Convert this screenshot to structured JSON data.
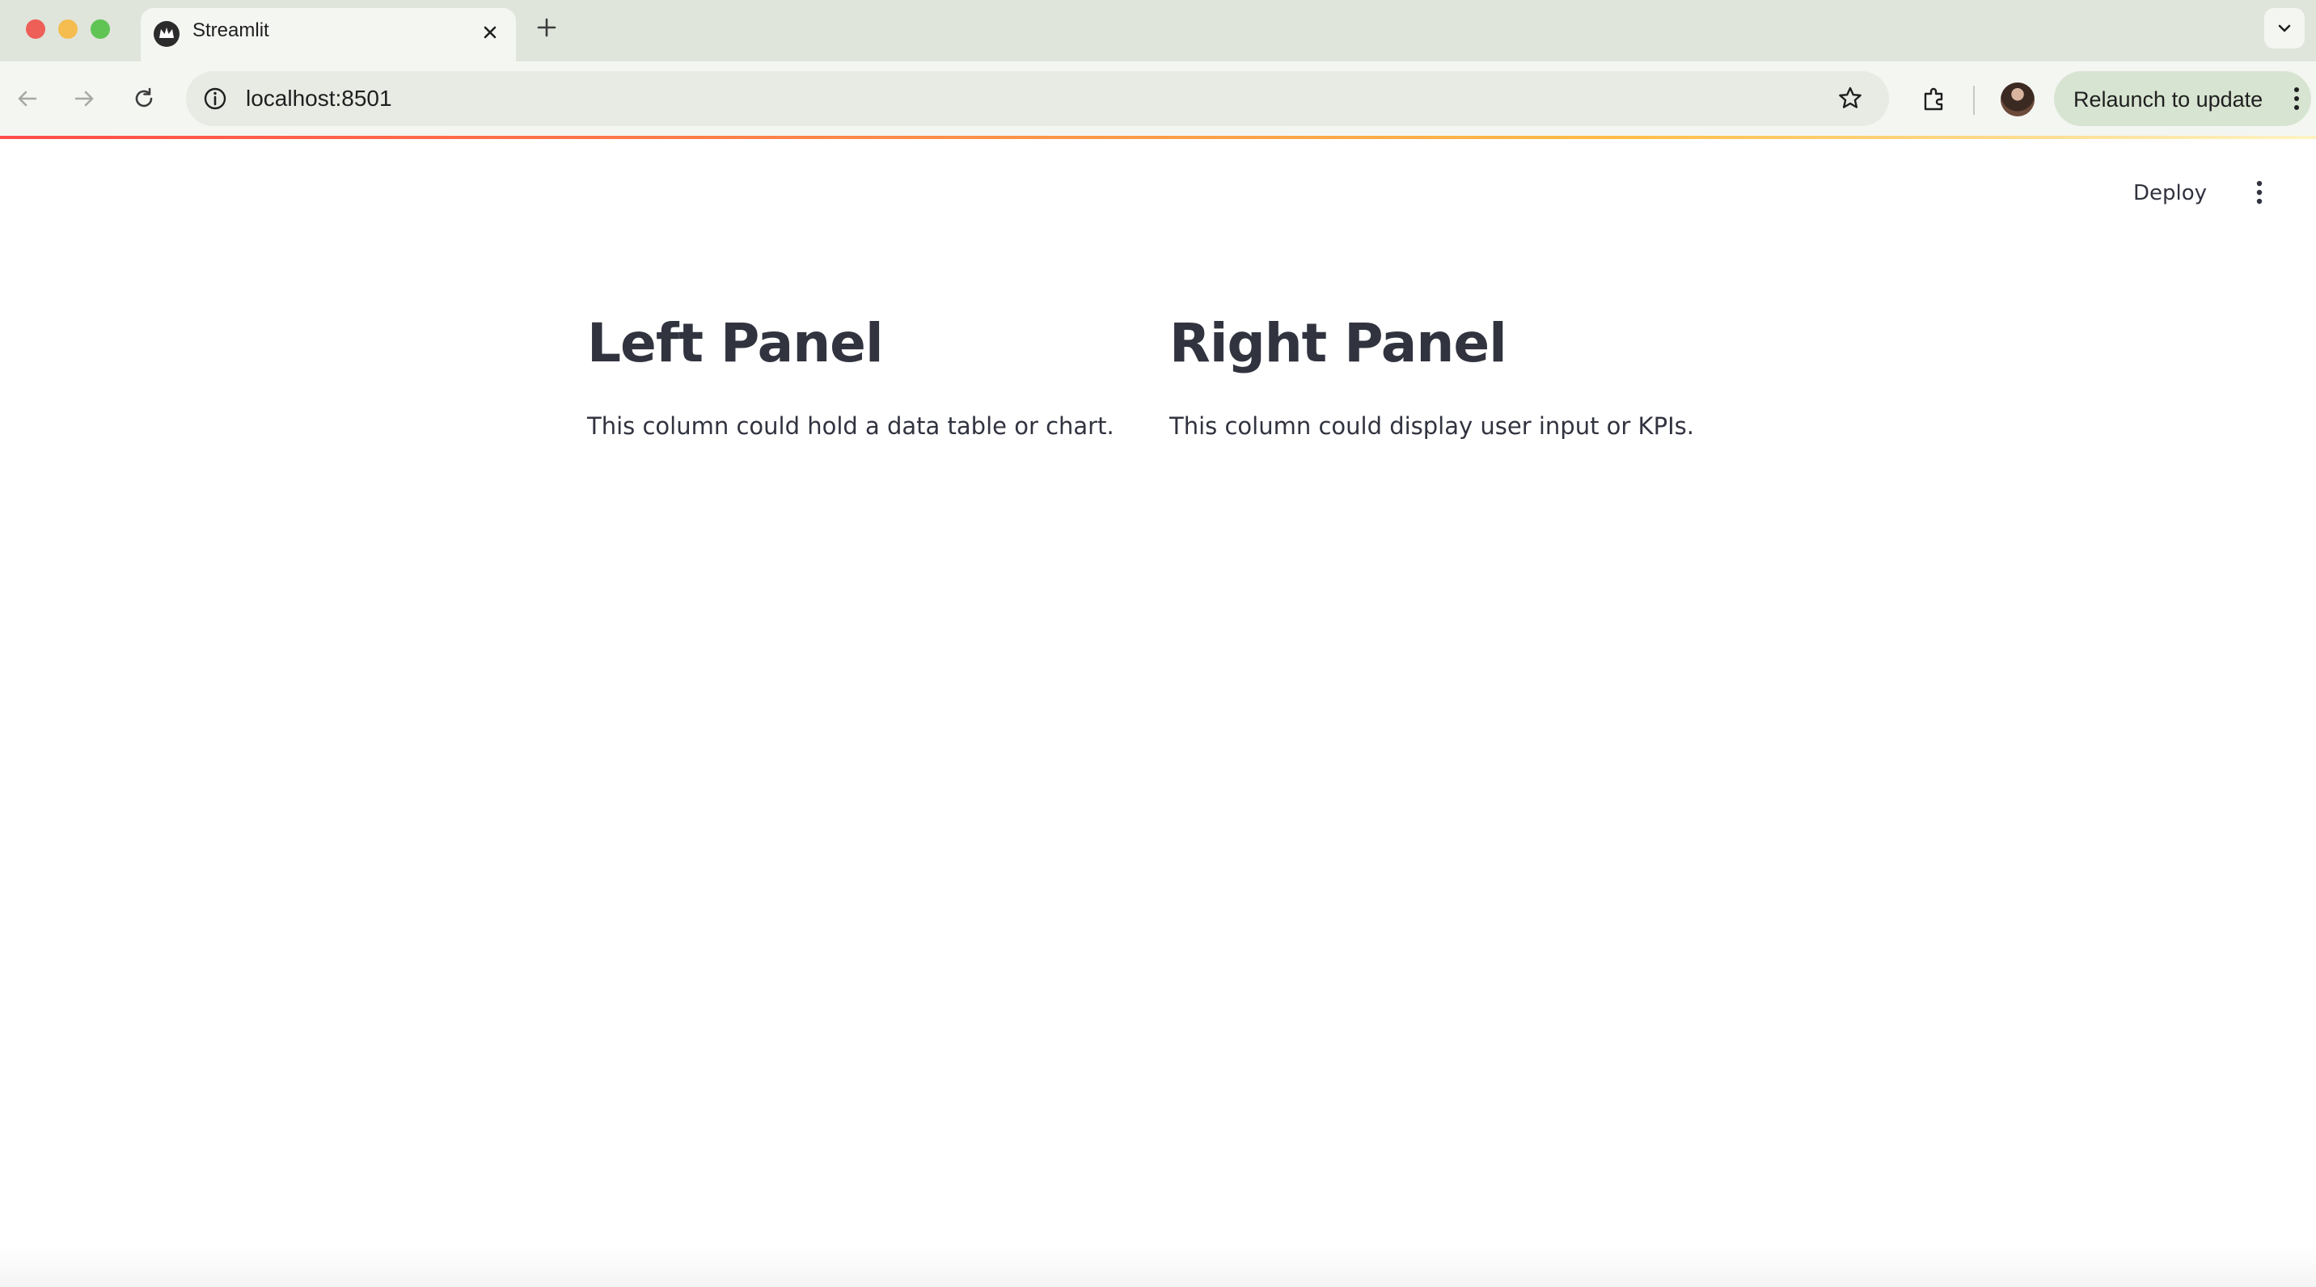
{
  "browser": {
    "tab": {
      "title": "Streamlit"
    },
    "url": "localhost:8501",
    "relaunch_label": "Relaunch to update"
  },
  "app": {
    "header": {
      "deploy_label": "Deploy"
    },
    "columns": [
      {
        "heading": "Left Panel",
        "text": "This column could hold a data table or chart."
      },
      {
        "heading": "Right Panel",
        "text": "This column could display user input or KPIs."
      }
    ]
  },
  "colors": {
    "accent": "#ff4b4b",
    "text": "#31333f"
  }
}
